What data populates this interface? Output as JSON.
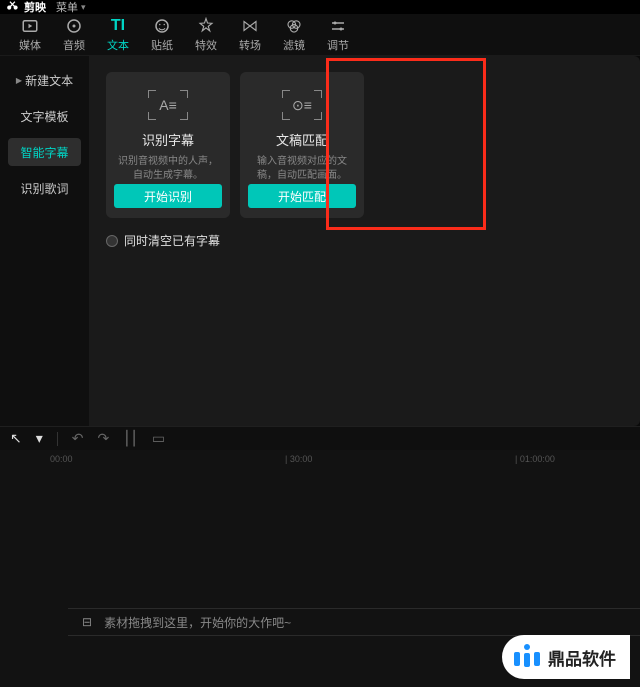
{
  "titlebar": {
    "app_name": "剪映",
    "menu_label": "菜单"
  },
  "toolbar": [
    {
      "icon": "media-icon",
      "label": "媒体"
    },
    {
      "icon": "audio-icon",
      "label": "音频"
    },
    {
      "icon": "text-icon",
      "label": "文本",
      "active": true
    },
    {
      "icon": "sticker-icon",
      "label": "贴纸"
    },
    {
      "icon": "effect-icon",
      "label": "特效"
    },
    {
      "icon": "transition-icon",
      "label": "转场"
    },
    {
      "icon": "filter-icon",
      "label": "滤镜"
    },
    {
      "icon": "adjust-icon",
      "label": "调节"
    }
  ],
  "sidebar": [
    {
      "label": "新建文本",
      "has_arrow": true
    },
    {
      "label": "文字模板"
    },
    {
      "label": "智能字幕",
      "active": true
    },
    {
      "label": "识别歌词"
    }
  ],
  "cards": [
    {
      "title": "识别字幕",
      "desc": "识别音视频中的人声，自动生成字幕。",
      "button": "开始识别"
    },
    {
      "title": "文稿匹配",
      "desc": "输入音视频对应的文稿，自动匹配画面。",
      "button": "开始匹配"
    }
  ],
  "clear_existing_label": "同时清空已有字幕",
  "ruler": {
    "t0": "00:00",
    "t1": "| 30:00",
    "t2": "| 01:00:00"
  },
  "timeline": {
    "placeholder": "素材拖拽到这里，开始你的大作吧~"
  },
  "watermark": "鼎品软件"
}
